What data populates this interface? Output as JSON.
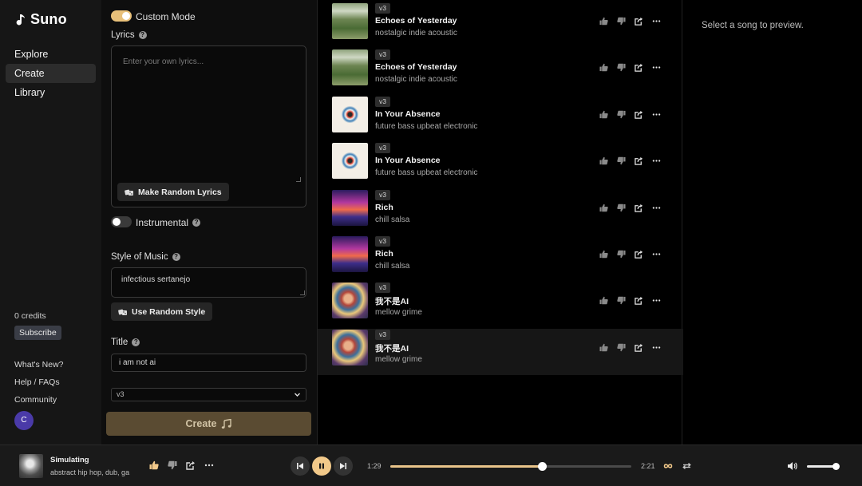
{
  "app": {
    "brand": "Suno"
  },
  "sidebar": {
    "nav": [
      {
        "label": "Explore",
        "active": false
      },
      {
        "label": "Create",
        "active": true
      },
      {
        "label": "Library",
        "active": false
      }
    ],
    "credits": "0 credits",
    "subscribe": "Subscribe",
    "links": [
      "What's New?",
      "Help / FAQs",
      "Community"
    ],
    "avatar_initial": "C"
  },
  "create": {
    "custom_mode_label": "Custom Mode",
    "custom_mode_on": true,
    "lyrics_label": "Lyrics",
    "lyrics_placeholder": "Enter your own lyrics...",
    "lyrics_value": "",
    "random_lyrics_button": "Make Random Lyrics",
    "instrumental_label": "Instrumental",
    "instrumental_on": false,
    "style_label": "Style of Music",
    "style_value": "infectious sertanejo",
    "random_style_button": "Use Random Style",
    "title_label": "Title",
    "title_value": "i am not ai",
    "version_value": "v3",
    "create_button": "Create"
  },
  "songs": [
    {
      "version": "v3",
      "title": "Echoes of Yesterday",
      "style": "nostalgic indie acoustic",
      "art": "landscape"
    },
    {
      "version": "v3",
      "title": "Echoes of Yesterday",
      "style": "nostalgic indie acoustic",
      "art": "landscape"
    },
    {
      "version": "v3",
      "title": "In Your Absence",
      "style": "future bass upbeat electronic",
      "art": "swirl"
    },
    {
      "version": "v3",
      "title": "In Your Absence",
      "style": "future bass upbeat electronic",
      "art": "swirl"
    },
    {
      "version": "v3",
      "title": "Rich",
      "style": "chill salsa",
      "art": "city"
    },
    {
      "version": "v3",
      "title": "Rich",
      "style": "chill salsa",
      "art": "city"
    },
    {
      "version": "v3",
      "title": "我不是AI",
      "style": "mellow grime",
      "art": "portrait"
    },
    {
      "version": "v3",
      "title": "我不是AI",
      "style": "mellow grime",
      "art": "portrait",
      "active": true
    }
  ],
  "preview": {
    "empty_text": "Select a song to preview."
  },
  "player": {
    "title": "Simulating",
    "style": "abstract hip hop, dub, ga",
    "elapsed": "1:29",
    "duration": "2:21",
    "progress_fraction": 0.63,
    "volume_fraction": 0.9
  },
  "icons": {
    "logo": "waveform-note-icon",
    "like": "thumbs-up-icon",
    "dislike": "thumbs-down-icon",
    "share": "share-icon",
    "more": "more-icon"
  },
  "colors": {
    "accent": "#e8c07a",
    "create_button": "#5a4b32",
    "avatar": "#4a3aa8"
  }
}
